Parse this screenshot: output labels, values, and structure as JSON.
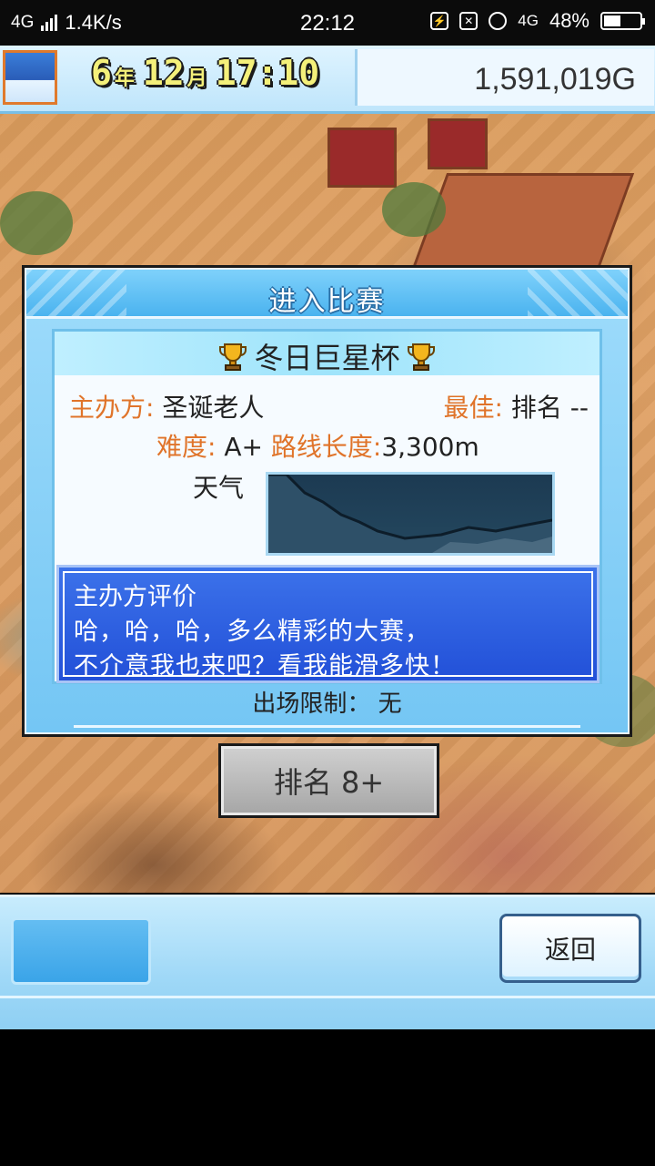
{
  "status_bar": {
    "network": "4G",
    "speed": "1.4K/s",
    "time": "22:12",
    "network2": "4G",
    "battery": "48%",
    "battery_level": 0.48
  },
  "hud": {
    "year": "6",
    "year_unit": "年",
    "month": "12",
    "month_unit": "月",
    "clock": "17:10",
    "money": "1,591,019G"
  },
  "dialog": {
    "title": "进入比赛",
    "cup_name": "冬日巨星杯",
    "organizer_label": "主办方:",
    "organizer_value": "圣诞老人",
    "best_label": "最佳:",
    "best_value": "排名 --",
    "difficulty_label": "难度:",
    "difficulty_value": "A+",
    "route_label": "路线长度:",
    "route_value": "3,300m",
    "weather_label": "天气",
    "comment_title": "主办方评价",
    "comment_line1": "哈，哈，哈，多么精彩的大赛，",
    "comment_line2": "不介意我也来吧？看我能滑多快！",
    "limit": "出场限制： 无"
  },
  "rank_button": {
    "label": "排名 8+"
  },
  "bottom_bar": {
    "back_label": "返回"
  }
}
